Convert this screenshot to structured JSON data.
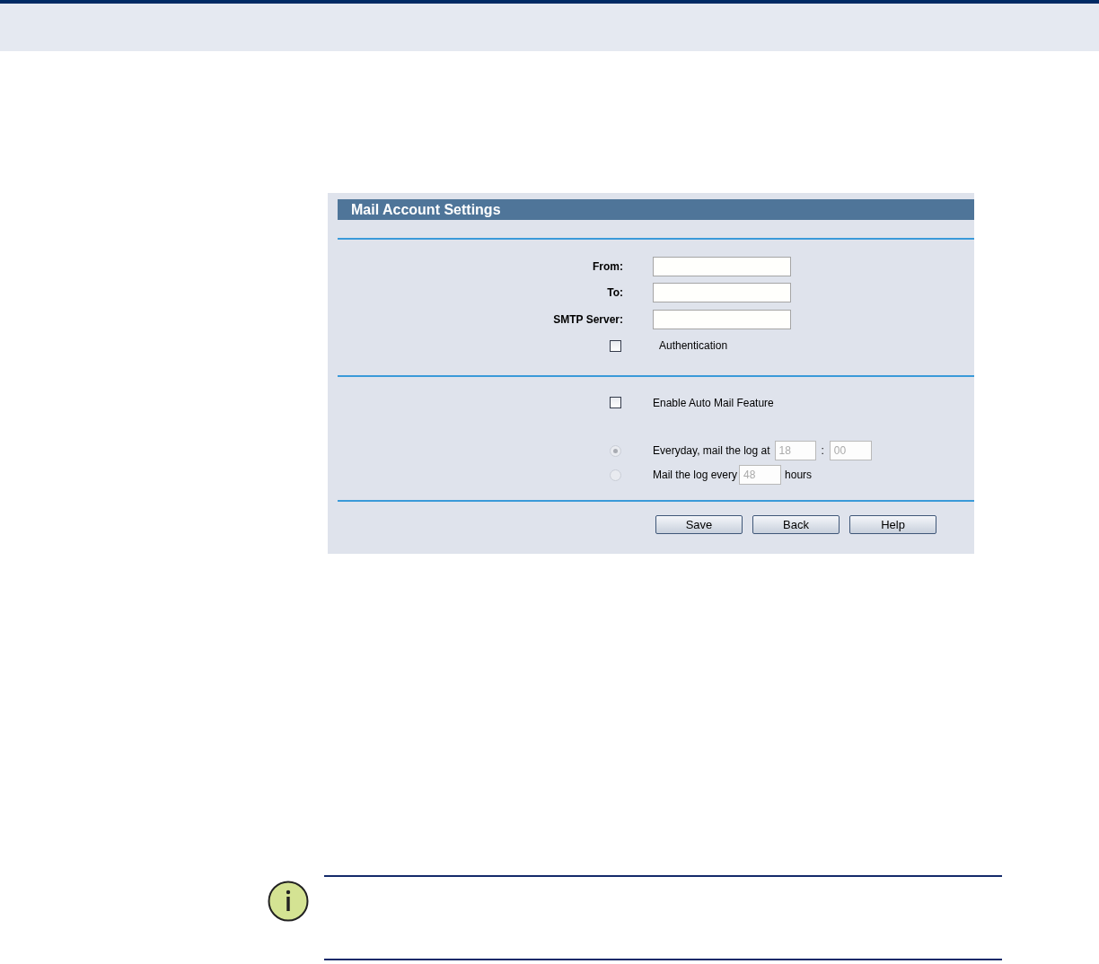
{
  "panel": {
    "title": "Mail Account Settings",
    "fields": [
      {
        "label": "From:"
      },
      {
        "label": "To:"
      },
      {
        "label": "SMTP Server:"
      }
    ],
    "authentication": {
      "label": "Authentication",
      "checked": false
    },
    "auto_mail": {
      "label": "Enable Auto Mail Feature",
      "checked": false
    },
    "schedule": [
      {
        "kind": "daily",
        "text": "Everyday, mail the log at",
        "hour": "18",
        "separator": ":",
        "minute": "00",
        "selected": true,
        "disabled": true
      },
      {
        "kind": "interval",
        "text": "Mail the log every",
        "hours": "48",
        "unit": "hours",
        "selected": false,
        "disabled": true
      }
    ],
    "buttons": [
      "Save",
      "Back",
      "Help"
    ]
  }
}
